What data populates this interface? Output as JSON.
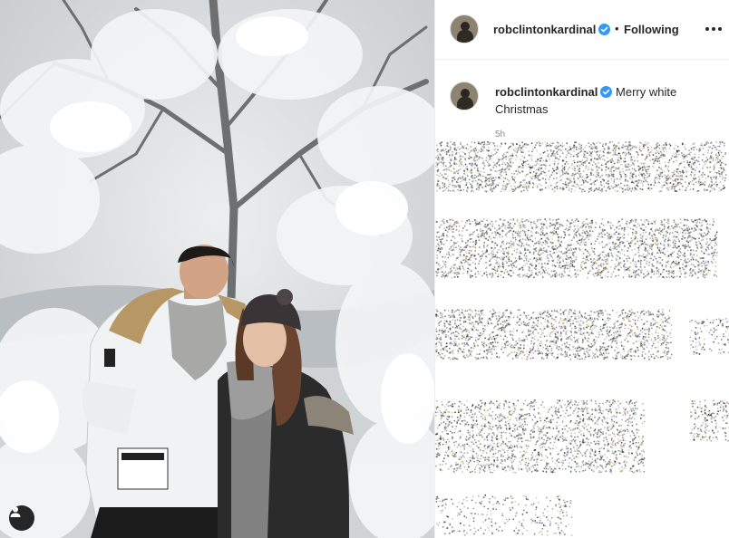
{
  "post": {
    "username": "robclintonkardinal",
    "follow_status": "Following",
    "separator": "•",
    "caption_text": "Merry white Christmas",
    "timestamp": "5h"
  },
  "icons": {
    "verified": "verified-badge-icon",
    "more": "more-options-icon",
    "user_tag": "user-tag-icon"
  },
  "colors": {
    "verified_blue": "#3897f0",
    "text": "#262626",
    "secondary_text": "#8e8e8e",
    "border": "#efefef"
  }
}
